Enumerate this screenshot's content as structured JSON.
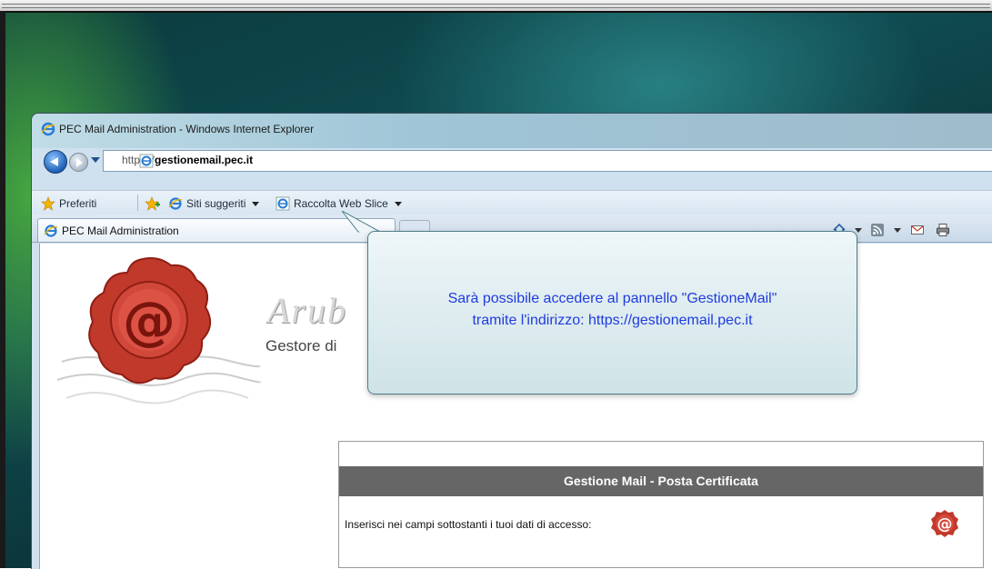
{
  "window": {
    "title": "PEC Mail Administration - Windows Internet Explorer"
  },
  "address_bar": {
    "url_prefix": "https://",
    "url_domain": "gestionemail.pec.it"
  },
  "favorites_bar": {
    "favorites_label": "Preferiti",
    "suggested_sites_label": "Siti suggeriti",
    "web_slice_label": "Raccolta Web Slice"
  },
  "tabs": [
    {
      "label": "PEC Mail Administration"
    }
  ],
  "page": {
    "brand_partial": "Arub",
    "subtitle_partial": "Gestore di",
    "panel_title": "Gestione Mail - Posta Certificata",
    "panel_instruction": "Inserisci nei campi sottostanti i tuoi dati di accesso:"
  },
  "callout": {
    "line1": "Sarà possibile accedere al pannello \"GestioneMail\"",
    "line2": "tramite l'indirizzo: https://gestionemail.pec.it"
  },
  "colors": {
    "callout_text": "#1f3be0",
    "panel_header_bg": "#666666",
    "seal_red": "#c0392b"
  }
}
